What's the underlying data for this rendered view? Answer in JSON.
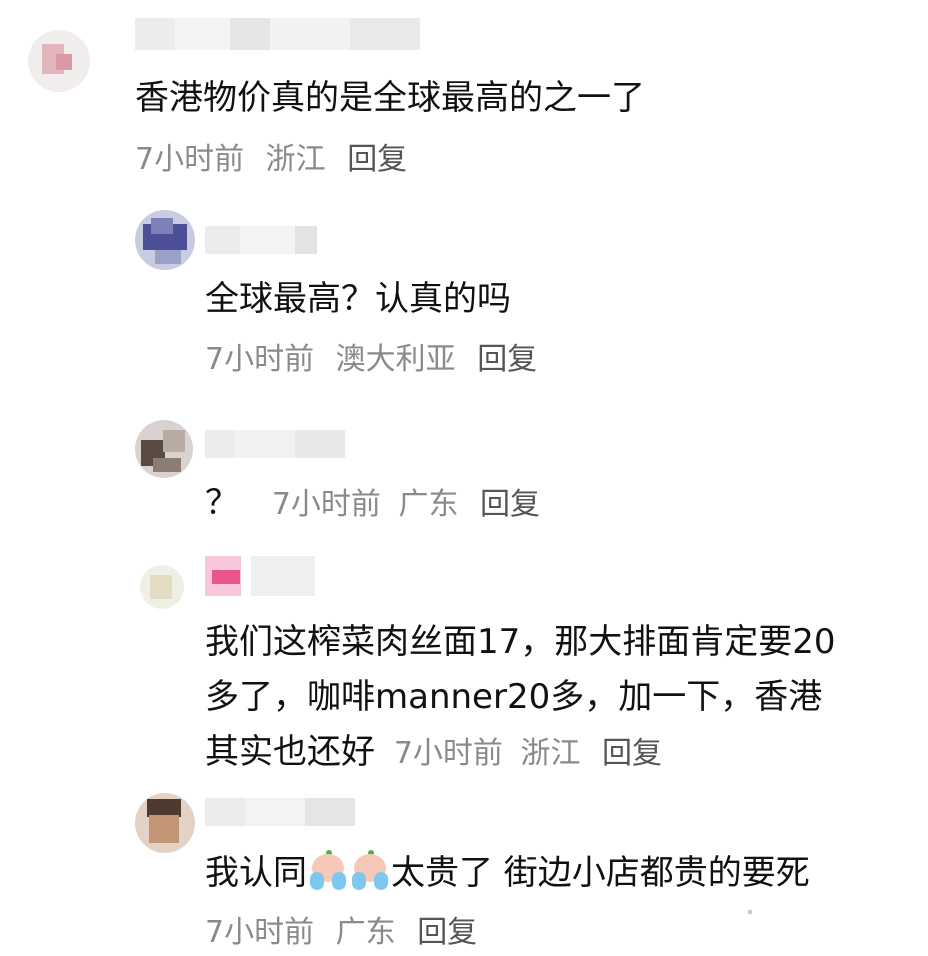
{
  "comments": [
    {
      "text": "香港物价真的是全球最高的之一了",
      "time": "7小时前",
      "location": "浙江",
      "reply_label": "回复"
    },
    {
      "text": "全球最高？认真的吗",
      "time": "7小时前",
      "location": "澳大利亚",
      "reply_label": "回复"
    },
    {
      "text": "？",
      "time": "7小时前",
      "location": "广东",
      "reply_label": "回复"
    },
    {
      "lines": [
        "我们这榨菜肉丝面17，那大排面肯定要20",
        "多了，咖啡manner20多，加一下，香港",
        "其实也还好"
      ],
      "time": "7小时前",
      "location": "浙江",
      "reply_label": "回复"
    },
    {
      "text_before": "我认同",
      "emoji_names": [
        "crying-baby-emoji",
        "crying-baby-emoji"
      ],
      "text_after": "太贵了 街边小店都贵的要死",
      "time": "7小时前",
      "location": "广东",
      "reply_label": "回复"
    }
  ],
  "colors": {
    "text": "#111111",
    "meta": "#8a8a8a",
    "reply": "#555555"
  }
}
